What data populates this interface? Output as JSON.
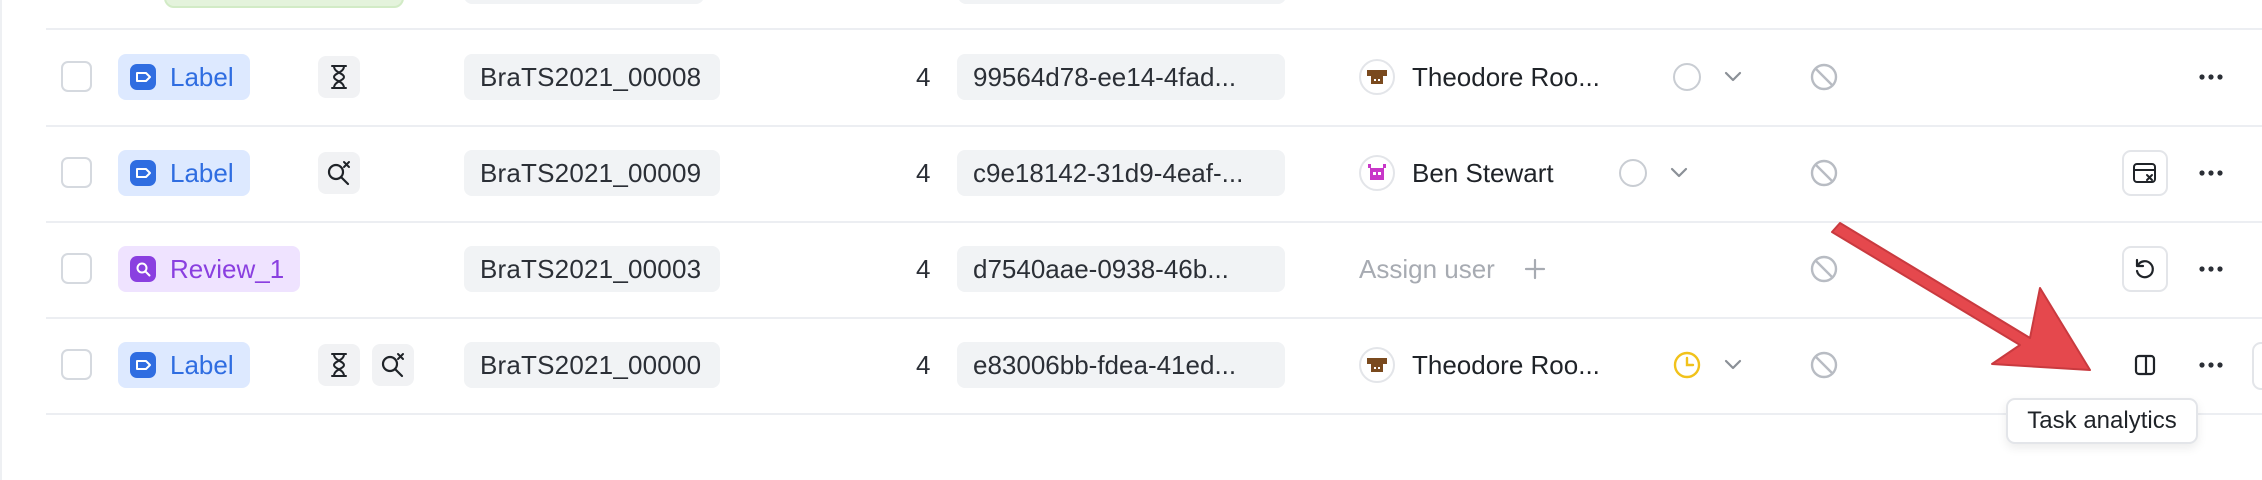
{
  "colors": {
    "label_blue": "#2f6de1",
    "review_purple": "#8a3fe0",
    "status_yellow": "#f1c21b",
    "annotation_red": "#e5484d"
  },
  "rows": [
    {
      "stage": "Label",
      "stage_kind": "label",
      "name": "BraTS2021_00008",
      "count": "4",
      "task_id": "99564d78-ee14-4fad...",
      "user": "Theodore Roo...",
      "action_icon": "none"
    },
    {
      "stage": "Label",
      "stage_kind": "label",
      "name": "BraTS2021_00009",
      "count": "4",
      "task_id": "c9e18142-31d9-4eaf-...",
      "user": "Ben Stewart",
      "action_icon": "calendar-x-icon"
    },
    {
      "stage": "Review_1",
      "stage_kind": "review",
      "name": "BraTS2021_00003",
      "count": "4",
      "task_id": "d7540aae-0938-46b...",
      "assign_placeholder": "Assign user",
      "action_icon": "reset-icon"
    },
    {
      "stage": "Label",
      "stage_kind": "label",
      "name": "BraTS2021_00000",
      "count": "4",
      "task_id": "e83006bb-fdea-41ed...",
      "user": "Theodore Roo...",
      "action_icon": "panel-icon"
    }
  ],
  "tooltip": {
    "text": "Task analytics"
  }
}
